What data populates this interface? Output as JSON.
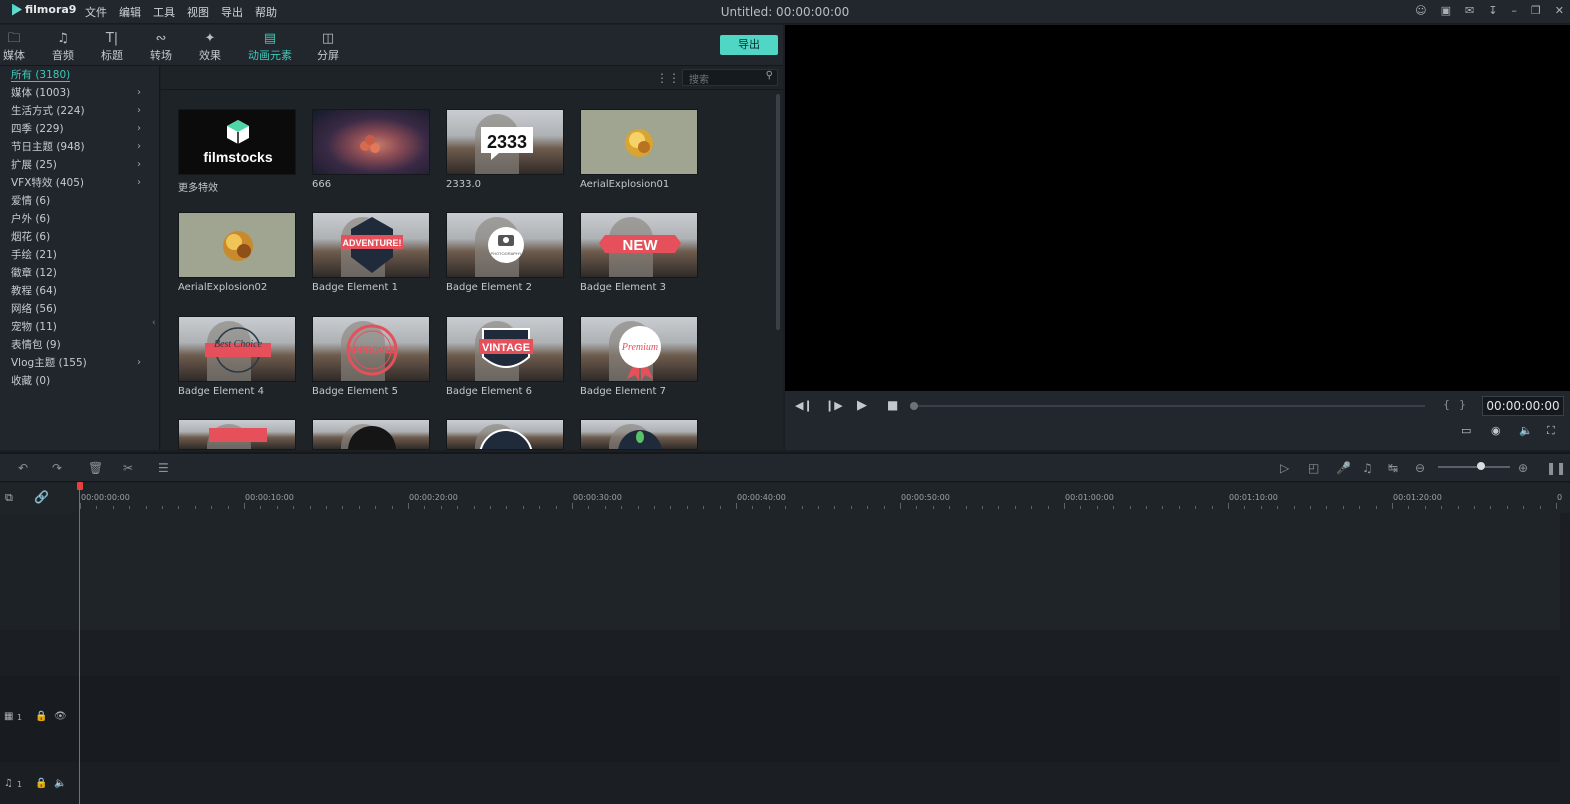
{
  "titlebar": {
    "logo": "filmora9",
    "menus": [
      "文件",
      "编辑",
      "工具",
      "视图",
      "导出",
      "帮助"
    ],
    "window_title": "Untitled: 00:00:00:00"
  },
  "media_tabs": [
    {
      "label": "媒体",
      "icon": "folder-icon"
    },
    {
      "label": "音频",
      "icon": "music-note-icon"
    },
    {
      "label": "标题",
      "icon": "text-icon"
    },
    {
      "label": "转场",
      "icon": "transition-icon"
    },
    {
      "label": "效果",
      "icon": "effects-icon"
    },
    {
      "label": "动画元素",
      "icon": "image-icon",
      "active": true
    },
    {
      "label": "分屏",
      "icon": "split-screen-icon"
    }
  ],
  "export_label": "导出",
  "categories": [
    {
      "label": "所有 (3180)",
      "active": true
    },
    {
      "label": "媒体 (1003)",
      "arrow": true
    },
    {
      "label": "生活方式 (224)",
      "arrow": true
    },
    {
      "label": "四季 (229)",
      "arrow": true
    },
    {
      "label": "节日主题 (948)",
      "arrow": true
    },
    {
      "label": "扩展 (25)",
      "arrow": true
    },
    {
      "label": "VFX特效 (405)",
      "arrow": true
    },
    {
      "label": "爱情 (6)"
    },
    {
      "label": "户外 (6)"
    },
    {
      "label": "烟花 (6)"
    },
    {
      "label": "手绘 (21)"
    },
    {
      "label": "徽章 (12)"
    },
    {
      "label": "教程 (64)"
    },
    {
      "label": "网络 (56)"
    },
    {
      "label": "宠物 (11)"
    },
    {
      "label": "表情包 (9)"
    },
    {
      "label": "Vlog主题 (155)",
      "arrow": true
    },
    {
      "label": "收藏 (0)"
    }
  ],
  "search": {
    "placeholder": "搜索"
  },
  "items": [
    {
      "caption": "更多特效",
      "thumb_text": "filmstocks"
    },
    {
      "caption": "666"
    },
    {
      "caption": "2333.0",
      "thumb_text": "2333"
    },
    {
      "caption": "AerialExplosion01"
    },
    {
      "caption": "AerialExplosion02"
    },
    {
      "caption": "Badge Element 1",
      "thumb_text": "ADVENTURE!"
    },
    {
      "caption": "Badge Element 2",
      "thumb_text": "PHOTOGRAPHY"
    },
    {
      "caption": "Badge Element 3",
      "thumb_text": "NEW"
    },
    {
      "caption": "Badge Element 4",
      "thumb_text": "Best Choice"
    },
    {
      "caption": "Badge Element 5",
      "thumb_text": "APPROVED"
    },
    {
      "caption": "Badge Element 6",
      "thumb_text": "VINTAGE"
    },
    {
      "caption": "Badge Element 7",
      "thumb_text": "Premium"
    }
  ],
  "preview": {
    "timecode": "00:00:00:00"
  },
  "ruler_labels": [
    "00:00:00:00",
    "00:00:10:00",
    "00:00:20:00",
    "00:00:30:00",
    "00:00:40:00",
    "00:00:50:00",
    "00:01:00:00",
    "00:01:10:00",
    "00:01:20:00",
    "0"
  ],
  "tracks": {
    "video_num": "1",
    "audio_num": "1"
  },
  "colors": {
    "accent": "#3ec8b8",
    "playhead": "#e8413b",
    "export_button": "#4fd6c4"
  }
}
